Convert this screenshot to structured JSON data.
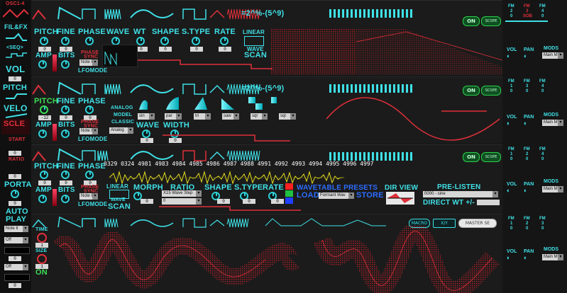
{
  "left": {
    "osc_label": "OSC1-4",
    "filfx": "FIL&FX",
    "seq": "<SEQ>",
    "vol": "VOL",
    "vol_val": "0",
    "pitch": "PITCH",
    "velo": "VELO",
    "scle": "SCLE",
    "start": "START",
    "start_val": "0",
    "ratio": "RATIO",
    "ratio_val": "0",
    "porta": "PORTA",
    "porta_val": "0",
    "autoplay1": "AUTO",
    "autoplay2": "PLAY",
    "dd_note": "Note Ir",
    "dd_off1": "Off",
    "dd_off2": "Off",
    "dd_val1": "0",
    "dd_val2": "0"
  },
  "osc1": {
    "labels": [
      "PITCH",
      "FINE",
      "PHASE",
      "WAVE",
      "WT",
      "SHAPE",
      "S.TYPE",
      "RATE",
      "LINEAR"
    ],
    "values": [
      "0",
      "0",
      "0",
      "0",
      "0",
      "0",
      "0",
      "0"
    ],
    "amp": "AMP",
    "bits": "BITS",
    "phase_sync": "PHASE",
    "sync": "SYNC",
    "note": "Note Ir",
    "lfomode": "LFOMODE",
    "wave": "WAVE",
    "scan": "SCAN",
    "formula": "=2^%-(5^9)",
    "on": "ON",
    "scope": "SCOPE"
  },
  "osc2": {
    "labels": [
      "PITCH",
      "FINE",
      "PHASE"
    ],
    "pitch_val": "-12",
    "values": [
      "0",
      "0"
    ],
    "amp": "AMP",
    "bits": "BITS",
    "phase_sync": "PHASE",
    "sync": "SYNC",
    "note": "Note Ir",
    "lfomode": "LFOMODE",
    "analog": "ANALOG",
    "model": "MODEL",
    "classic": "CLASSIC",
    "analog_sel": "Analog",
    "wave": "WAVE",
    "width": "WIDTH",
    "wave_val": "0",
    "width_val": "0",
    "shapes": [
      "sin",
      "par",
      "tri",
      "saw",
      "sqr",
      "sqr"
    ],
    "formula": "=2^%-(5^9)",
    "on": "ON",
    "scope": "SCOPE"
  },
  "osc3": {
    "labels": [
      "PITCH",
      "FINE",
      "PHASE"
    ],
    "values": [
      "0",
      "0",
      "0"
    ],
    "amp": "AMP",
    "bits": "BITS",
    "phase_sync": "PHASE",
    "sync": "SYNC",
    "note": "Note Ir",
    "lfomode": "LFOMODE",
    "linear": "LINEAR",
    "wave": "WAVE",
    "scan": "SCAN",
    "morph": "MORPH",
    "ratio": "RATIO",
    "shape": "SHAPE",
    "stype": "S.TYPE",
    "rate": "RATE",
    "morph_val": "0",
    "ratio_sel": "X15 Wave Step",
    "ratio_sel2": "0",
    "shape_val": "0",
    "stype_val": "0",
    "rate_val": "0",
    "digits": "0329 0324 4981 4983 4984 4985 4986 4987 4988 4991 4992 4993 4994 4995 4996 4997",
    "wt_presets": "WAVETABLE PRESETS",
    "load": "LOAD",
    "formant": "Formant Wav",
    "store": "STORE",
    "dirview": "DIR VIEW",
    "prelisten": "PRE-LISTEN",
    "preset_sel": "0000 - sine",
    "direct_wt": "DIRECT WT +/-",
    "on": "ON",
    "scope": "SCOPE"
  },
  "osc4": {
    "time": "TIME",
    "time_val": "1",
    "size": "SIZE",
    "size_val": "1",
    "on": "ON",
    "macro": "MACRO",
    "xy": "X/Y",
    "master": "MASTER SE"
  },
  "right": {
    "rows": [
      {
        "fm": [
          "FM",
          "FM",
          "FM"
        ],
        "fmv": [
          "2",
          "3",
          "4"
        ],
        "fmsub": [
          "",
          "SOB",
          ""
        ],
        "vol": "VOL",
        "pan": "PAN",
        "mods": "MODS",
        "mods_sel": "Main M"
      },
      {
        "fm": [
          "FM",
          "FM",
          "FM"
        ],
        "fmv": [
          "1",
          "3",
          "4"
        ],
        "fmsub": [
          "",
          "",
          ""
        ],
        "vol": "VOL",
        "pan": "PAN",
        "mods": "MODS",
        "mods_sel": "Main M"
      },
      {
        "fm": [
          "FM",
          "FM",
          "FM"
        ],
        "fmv": [
          "1",
          "2",
          "4"
        ],
        "fmsub": [
          "",
          "",
          ""
        ],
        "vol": "VOL",
        "pan": "PAN",
        "mods": "MODS",
        "mods_sel": "Main M"
      },
      {
        "fm": [
          "FM",
          "FM",
          "FM"
        ],
        "fmv": [
          "1",
          "2",
          "3"
        ],
        "fmsub": [
          "",
          "",
          ""
        ],
        "vol": "VOL",
        "pan": "PAN",
        "mods": "MODS",
        "mods_sel": "Main M"
      }
    ],
    "fm_vals": [
      "0",
      "0",
      "0"
    ]
  },
  "colors": {
    "accent": "#3fe0e6",
    "red": "#e0303a",
    "green": "#3ddc55",
    "bg": "#151515"
  }
}
